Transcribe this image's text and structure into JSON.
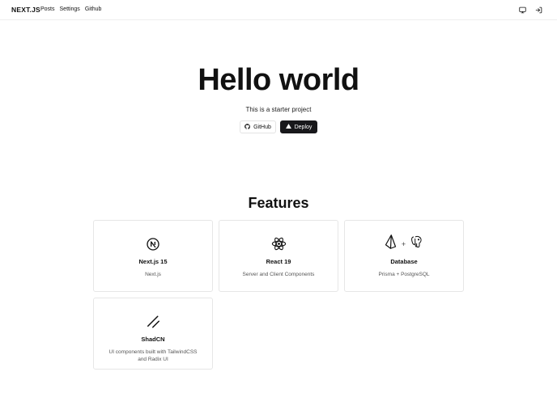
{
  "header": {
    "brand": "NEXT.JS",
    "nav": [
      {
        "label": "Posts"
      },
      {
        "label": "Settings"
      },
      {
        "label": "Github"
      }
    ],
    "icons": [
      "monitor-icon",
      "sign-in-icon"
    ]
  },
  "hero": {
    "title": "Hello world",
    "subtitle": "This is a starter project",
    "github_label": "GitHub",
    "deploy_label": "Deploy"
  },
  "features": {
    "title": "Features",
    "cards": [
      {
        "title": "Next.js 15",
        "description": "Next.js",
        "icon": "nextjs-icon"
      },
      {
        "title": "React 19",
        "description": "Server and Client Components",
        "icon": "react-icon"
      },
      {
        "title": "Database",
        "description": "Prisma + PostgreSQL",
        "icon": "prisma-postgres-icon",
        "plus": "+"
      },
      {
        "title": "ShadCN",
        "description": "UI components built with TailwindCSS and Radix UI",
        "icon": "shadcn-icon"
      }
    ]
  },
  "colors": {
    "text": "#111111",
    "muted": "#555555",
    "border": "#e6e6e6",
    "dark_button": "#18181b"
  }
}
